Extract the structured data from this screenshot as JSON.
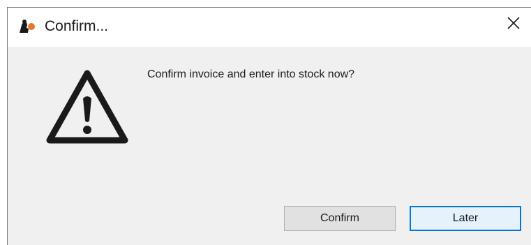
{
  "window": {
    "title": "Confirm...",
    "close_glyph": "✕",
    "app_icon": "app-logo-icon"
  },
  "dialog": {
    "icon": "warning-icon",
    "message": "Confirm invoice and enter into stock now?"
  },
  "buttons": {
    "confirm_label": "Confirm",
    "later_label": "Later"
  },
  "colors": {
    "background": "#f0f0f0",
    "titlebar": "#ffffff",
    "focus_border": "#0078d7",
    "app_icon_accent": "#e8762c"
  }
}
